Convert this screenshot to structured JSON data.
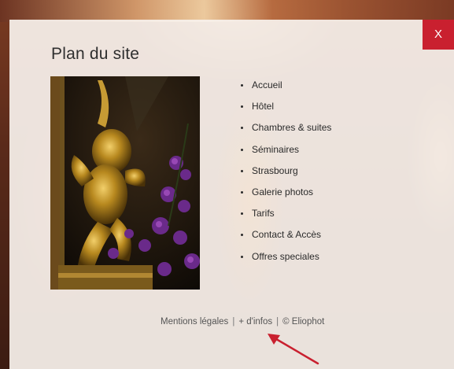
{
  "modal": {
    "title": "Plan du site",
    "close_label": "X"
  },
  "sitemap": {
    "items": [
      {
        "label": "Accueil"
      },
      {
        "label": "Hôtel"
      },
      {
        "label": "Chambres & suites"
      },
      {
        "label": "Séminaires"
      },
      {
        "label": "Strasbourg"
      },
      {
        "label": "Galerie photos"
      },
      {
        "label": "Tarifs"
      },
      {
        "label": "Contact & Accès"
      },
      {
        "label": "Offres speciales"
      }
    ]
  },
  "footer": {
    "legal": "Mentions légales",
    "separator": "|",
    "more_info": "+ d'infos",
    "copyright": "© Eliophot"
  },
  "icons": {
    "close": "close-icon",
    "arrow": "annotation-arrow-icon"
  },
  "colors": {
    "close_bg": "#c9202f",
    "arrow": "#c9202f",
    "modal_bg": "#f7f1ec"
  }
}
